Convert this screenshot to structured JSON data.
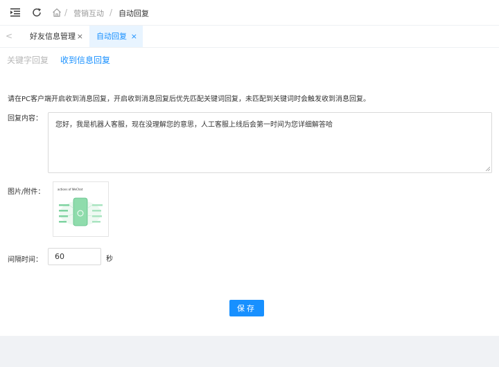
{
  "header": {
    "icons": [
      "menu-fold-icon",
      "refresh-icon",
      "home-icon"
    ],
    "breadcrumb": {
      "separator": "/",
      "items": [
        "营销互动",
        "自动回复"
      ]
    }
  },
  "tabs": [
    {
      "label": "好友信息管理",
      "active": false
    },
    {
      "label": "自动回复",
      "active": true
    }
  ],
  "tab_close_glyph": "×",
  "tab_prev_glyph": "<",
  "subtabs": [
    {
      "label": "关键字回复",
      "active": false
    },
    {
      "label": "收到信息回复",
      "active": true
    }
  ],
  "description": "请在PC客户端开启收到消息回复，开启收到消息回复后优先匹配关键词回复，未匹配到关键词时会触发收到消息回复。",
  "form": {
    "reply_content_label": "回复内容：",
    "reply_content_value": "您好，我是机器人客服，现在没理解您的意思，人工客服上线后会第一时间为您详细解答哈",
    "attachment_label": "图片/附件：",
    "attachment_thumbnail_title": "actions of WeChat",
    "interval_label": "间隔时间：",
    "interval_value": "60",
    "interval_unit": "秒"
  },
  "actions": {
    "save_label": "保存"
  },
  "colors": {
    "accent": "#1890ff",
    "active_tab_bg": "#e8f4ff",
    "footer_bg": "#f0f2f5",
    "thumb_green": "#7ed3a0"
  }
}
